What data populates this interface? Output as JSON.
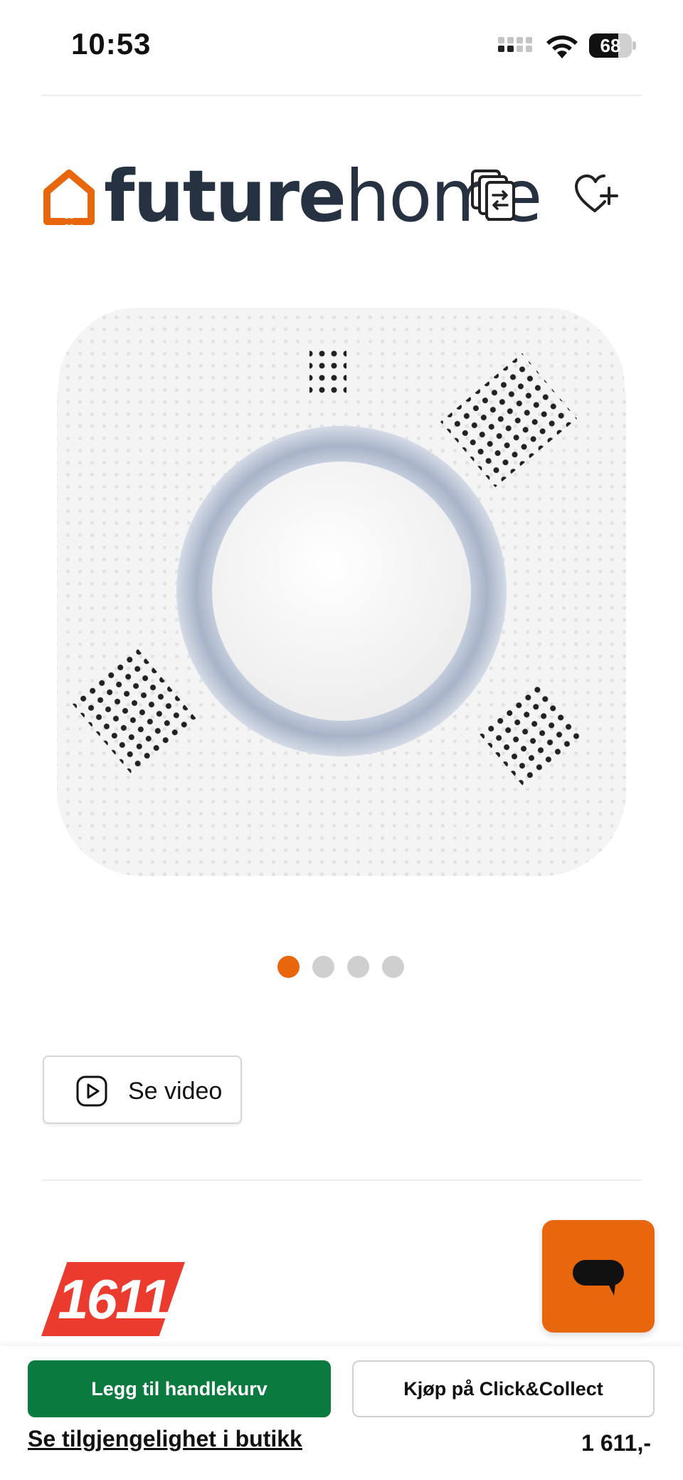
{
  "status_bar": {
    "time": "10:53",
    "battery_level": "68"
  },
  "brand": {
    "logo_text_bold": "future",
    "logo_text_light": "home",
    "accent_color": "#e8660c"
  },
  "product": {
    "image_icon": "smoke-detector-image",
    "carousel": {
      "total": 4,
      "active_index": 0
    }
  },
  "video_button": {
    "label": "Se video",
    "icon": "play-icon"
  },
  "price_badge": {
    "value": "1611",
    "color": "#ea3b2e"
  },
  "chat": {
    "icon": "chat-bubble-icon"
  },
  "bottom_bar": {
    "add_to_cart_label": "Legg til handlekurv",
    "click_collect_label": "Kjøp på Click&Collect",
    "availability_link": "Se tilgjengelighet i butikk",
    "price": "1 611,-",
    "primary_color": "#0b7a3e"
  }
}
